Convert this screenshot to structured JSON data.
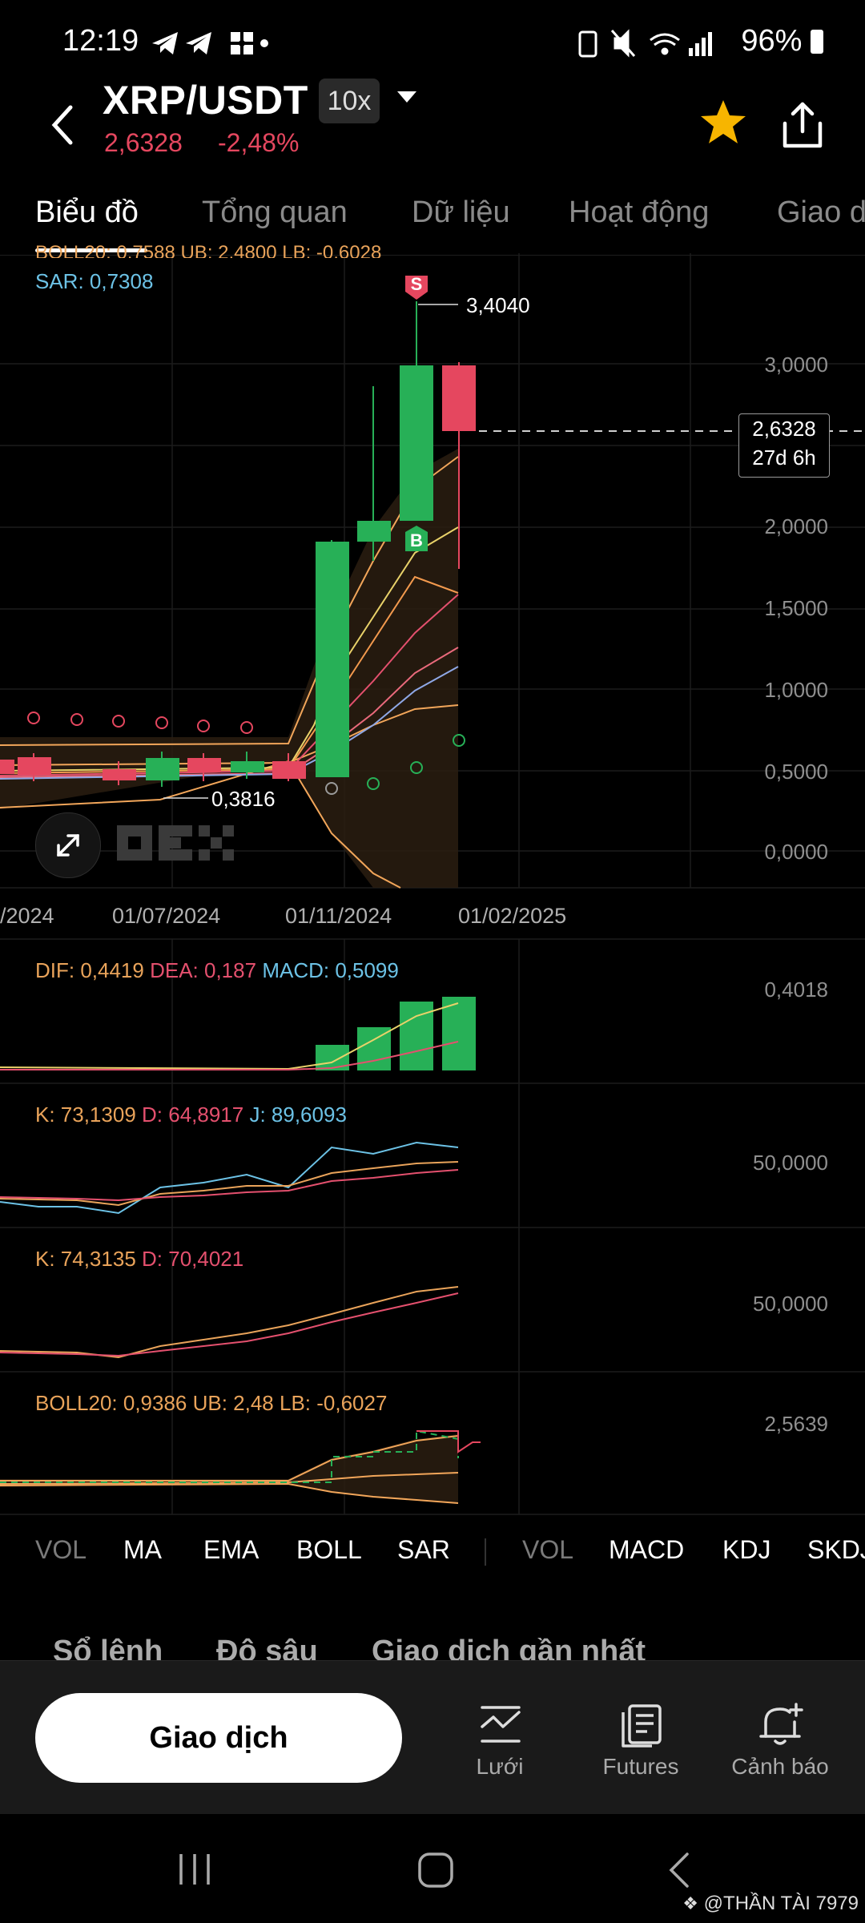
{
  "status": {
    "time": "12:19",
    "battery": "96%",
    "notif_icons": [
      "telegram-icon",
      "telegram-icon",
      "pinwheel-icon",
      "dot-icon"
    ],
    "sys_icons": [
      "battery-saver-icon",
      "mute-icon",
      "wifi-icon",
      "signal-icon"
    ]
  },
  "header": {
    "pair": "XRP/USDT",
    "leverage": "10x",
    "price": "2,6328",
    "change": "-2,48%",
    "accent_down": "#e5475f",
    "accent_up": "#27b057",
    "star_color": "#f7b500"
  },
  "tabs": [
    {
      "label": "Biểu đồ",
      "active": true
    },
    {
      "label": "Tổng quan",
      "active": false
    },
    {
      "label": "Dữ liệu",
      "active": false
    },
    {
      "label": "Hoạt động",
      "active": false
    },
    {
      "label": "Giao d",
      "active": false
    }
  ],
  "main_chart": {
    "boll_line": "BOLL20: 0,7588 UB: 2,4800 LB: -0,6028",
    "sar_line": "SAR: 0,7308",
    "high_label": "3,4040",
    "low_label": "0,3816",
    "sell_marker": "S",
    "buy_marker": "B",
    "y_labels": [
      "3,0000",
      "2,0000",
      "1,5000",
      "1,0000",
      "0,5000",
      "0,0000"
    ],
    "current_price": "2,6328",
    "countdown": "27d 6h",
    "x_labels": [
      "/2024",
      "01/07/2024",
      "01/11/2024",
      "01/02/2025"
    ],
    "watermark": "OKX"
  },
  "macd": {
    "dif": "DIF: 0,4419",
    "dea": "DEA: 0,187",
    "macd": "MACD: 0,5099",
    "y_label": "0,4018"
  },
  "kdj": {
    "k": "K: 73,1309",
    "d": "D: 64,8917",
    "j": "J: 89,6093",
    "y_label": "50,0000"
  },
  "skdj": {
    "k": "K: 74,3135",
    "d": "D: 70,4021",
    "y_label": "50,0000"
  },
  "boll_sub": {
    "line": "BOLL20: 0,9386 UB: 2,48 LB: -0,6027",
    "y_label": "2,5639"
  },
  "indicators": {
    "main": [
      {
        "label": "VOL",
        "dim": true
      },
      {
        "label": "MA",
        "dim": false
      },
      {
        "label": "EMA",
        "dim": false
      },
      {
        "label": "BOLL",
        "dim": false
      },
      {
        "label": "SAR",
        "dim": false
      }
    ],
    "sub": [
      {
        "label": "VOL",
        "dim": true
      },
      {
        "label": "MACD",
        "dim": false
      },
      {
        "label": "KDJ",
        "dim": false
      },
      {
        "label": "SKDJ",
        "dim": false
      }
    ]
  },
  "peek_tabs": [
    "Sổ lệnh",
    "Độ sâu",
    "Giao dịch gần nhất"
  ],
  "bottom": {
    "trade_button": "Giao dịch",
    "grid": "Lưới",
    "futures": "Futures",
    "alert": "Cảnh báo"
  },
  "watermark_text": "@THẦN TÀI 7979"
}
